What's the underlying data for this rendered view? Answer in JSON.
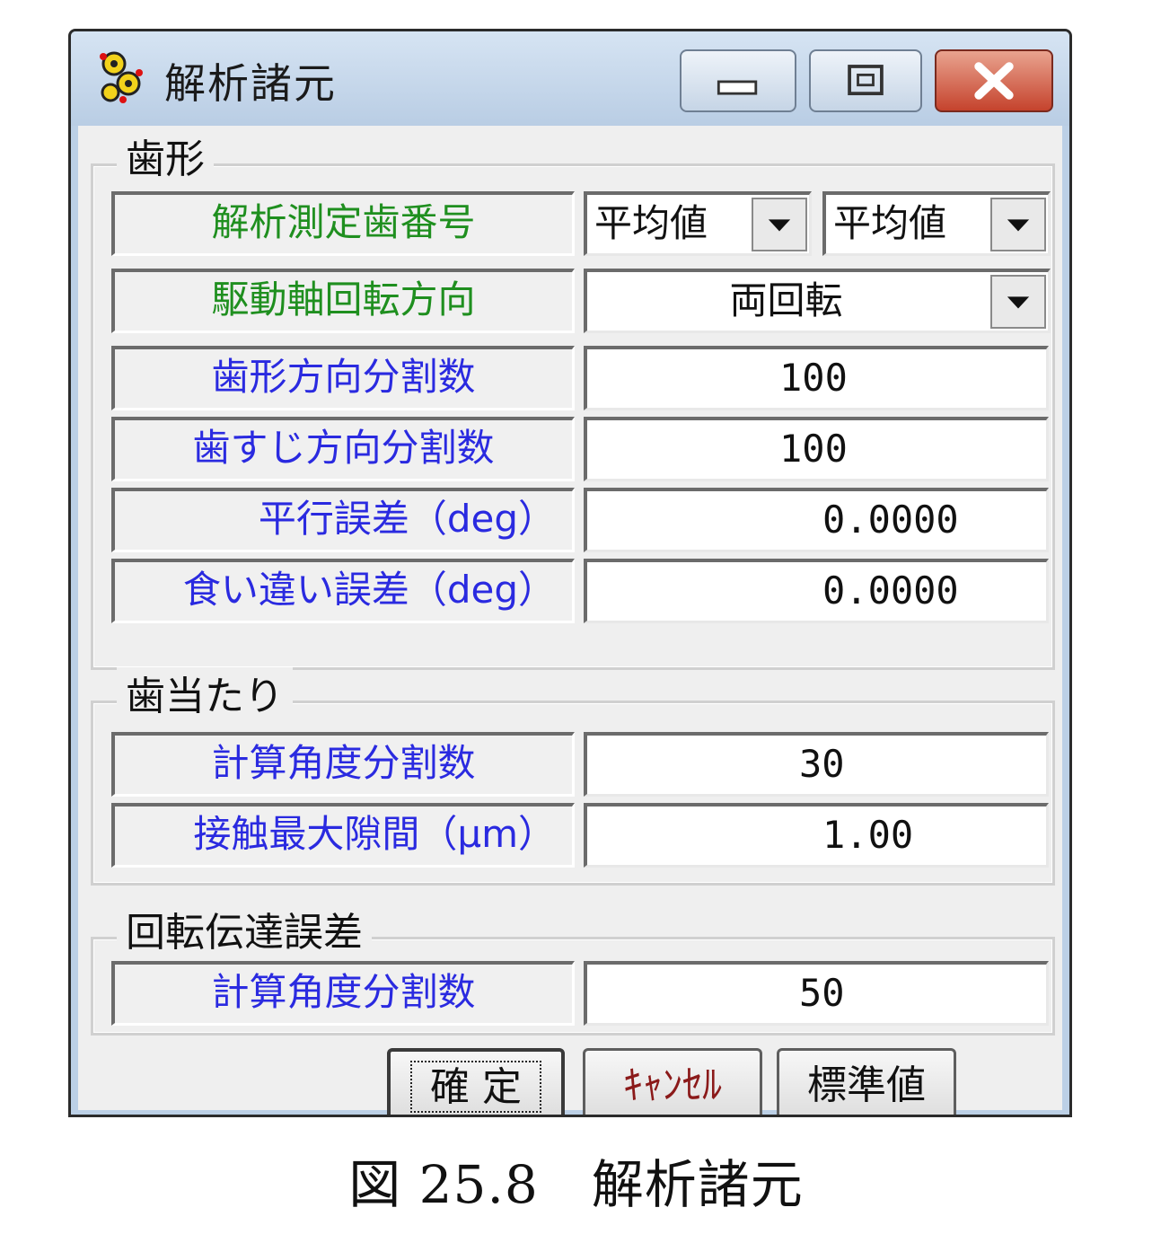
{
  "window": {
    "title": "解析諸元"
  },
  "groups": {
    "tooth_profile": {
      "legend": "歯形",
      "rows": {
        "analysis_tooth_number": {
          "label": "解析測定歯番号",
          "combo1": "平均値",
          "combo2": "平均値"
        },
        "drive_rotation_direction": {
          "label": "駆動軸回転方向",
          "value": "両回転"
        },
        "profile_divisions": {
          "label": "歯形方向分割数",
          "value": "100"
        },
        "lead_divisions": {
          "label": "歯すじ方向分割数",
          "value": "100"
        },
        "parallel_error": {
          "label": "平行誤差（deg）",
          "value": "0.0000"
        },
        "misalignment_error": {
          "label": "食い違い誤差（deg）",
          "value": "0.0000"
        }
      }
    },
    "tooth_contact": {
      "legend": "歯当たり",
      "rows": {
        "calc_angle_divisions": {
          "label": "計算角度分割数",
          "value": "30"
        },
        "max_contact_gap": {
          "label": "接触最大隙間（μm）",
          "value": "1.00"
        }
      }
    },
    "transmission_error": {
      "legend": "回転伝達誤差",
      "rows": {
        "calc_angle_divisions": {
          "label": "計算角度分割数",
          "value": "50"
        }
      }
    }
  },
  "buttons": {
    "ok": "確 定",
    "cancel": "ｷｬﾝｾﾙ",
    "default": "標準値"
  },
  "colors": {
    "label_green": "#1f8f1f",
    "label_blue": "#2a2ae0",
    "cancel_text": "#8b1a1a",
    "close_button": "#c5432d"
  },
  "caption": "図 25.8　解析諸元"
}
